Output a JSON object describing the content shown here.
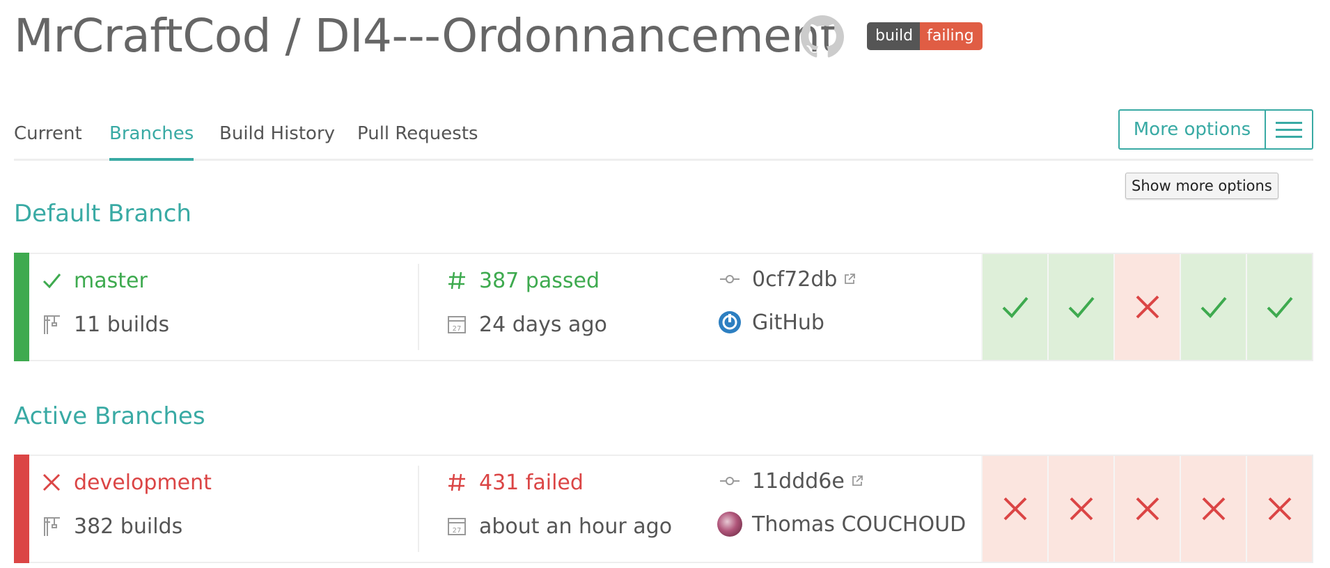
{
  "header": {
    "repo_title": "MrCraftCod / DI4---Ordonnancement",
    "badge": {
      "left": "build",
      "right": "failing"
    }
  },
  "tabs": [
    {
      "label": "Current"
    },
    {
      "label": "Branches",
      "active": true
    },
    {
      "label": "Build History"
    },
    {
      "label": "Pull Requests"
    }
  ],
  "more_options": {
    "label": "More options",
    "tooltip": "Show more options"
  },
  "sections": {
    "default_title": "Default Branch",
    "active_title": "Active Branches"
  },
  "default_branch": {
    "status": "passed",
    "name": "master",
    "builds": "11 builds",
    "build": "387 passed",
    "time": "24 days ago",
    "commit": "0cf72db",
    "author": "GitHub",
    "history": [
      "passed",
      "passed",
      "failed",
      "passed",
      "passed"
    ]
  },
  "active_branches": [
    {
      "status": "failed",
      "name": "development",
      "builds": "382 builds",
      "build": "431 failed",
      "time": "about an hour ago",
      "commit": "11ddd6e",
      "author": "Thomas COUCHOUD",
      "history": [
        "failed",
        "failed",
        "failed",
        "failed",
        "failed"
      ]
    }
  ],
  "colors": {
    "accent": "#39aaa4",
    "passed": "#3eaa4f",
    "failed": "#db4545",
    "badge_failing": "#e05d44"
  },
  "icons": {
    "github": "github-icon",
    "menu": "hamburger-icon",
    "check": "check-icon",
    "cross": "cross-icon",
    "hash": "hash-icon",
    "crane": "crane-icon",
    "calendar": "calendar-icon",
    "commit": "commit-icon",
    "external": "external-link-icon"
  }
}
